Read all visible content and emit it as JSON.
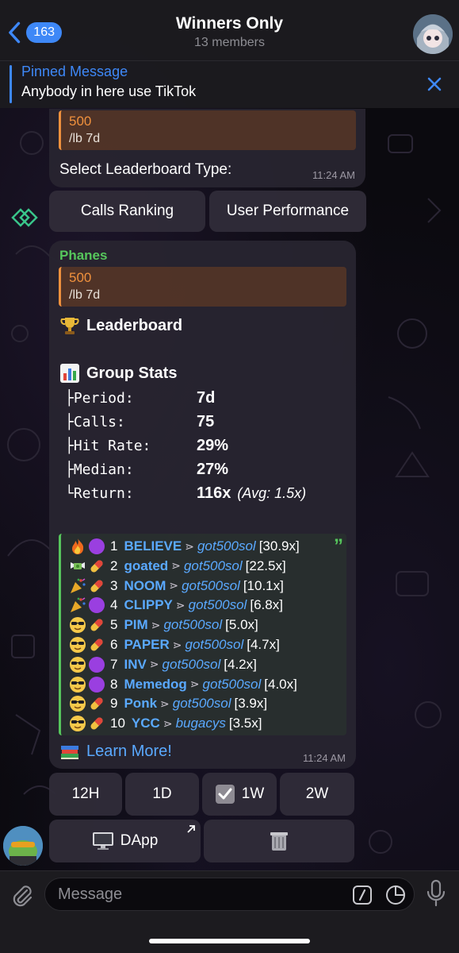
{
  "header": {
    "unread_count": "163",
    "title": "Winners Only",
    "subtitle": "13 members"
  },
  "pinned": {
    "title": "Pinned Message",
    "text": "Anybody in here use TikTok"
  },
  "message1": {
    "reply_title": "500",
    "reply_text": "/lb 7d",
    "text": "Select Leaderboard Type:",
    "time": "11:24 AM"
  },
  "keyboard1": {
    "calls_ranking": "Calls Ranking",
    "user_performance": "User Performance"
  },
  "message2": {
    "sender": "Phanes",
    "reply_title": "500",
    "reply_text": "/lb 7d",
    "leaderboard_title": "Leaderboard",
    "group_stats_title": "Group Stats",
    "stats": [
      {
        "label": "├Period:",
        "value": "7d",
        "note": ""
      },
      {
        "label": "├Calls:",
        "value": "75",
        "note": ""
      },
      {
        "label": "├Hit Rate:",
        "value": "29%",
        "note": ""
      },
      {
        "label": "├Median:",
        "value": "27%",
        "note": ""
      },
      {
        "label": "└Return:",
        "value": "116x",
        "note": "(Avg: 1.5x)"
      }
    ],
    "leaderboard": [
      {
        "icons": [
          "fire",
          "purple-circle"
        ],
        "rank": "1",
        "token": "BELIEVE",
        "user": "got500sol",
        "mult": "[30.9x]"
      },
      {
        "icons": [
          "money-with-wings",
          "pill"
        ],
        "rank": "2",
        "token": "goated",
        "user": "got500sol",
        "mult": "[22.5x]"
      },
      {
        "icons": [
          "party-popper",
          "pill"
        ],
        "rank": "3",
        "token": "NOOM",
        "user": "got500sol",
        "mult": "[10.1x]"
      },
      {
        "icons": [
          "party-popper",
          "purple-circle"
        ],
        "rank": "4",
        "token": "CLIPPY",
        "user": "got500sol",
        "mult": "[6.8x]"
      },
      {
        "icons": [
          "sunglasses-face",
          "pill"
        ],
        "rank": "5",
        "token": "PIM",
        "user": "got500sol",
        "mult": "[5.0x]"
      },
      {
        "icons": [
          "sunglasses-face",
          "pill"
        ],
        "rank": "6",
        "token": "PAPER",
        "user": "got500sol",
        "mult": "[4.7x]"
      },
      {
        "icons": [
          "sunglasses-face",
          "purple-circle"
        ],
        "rank": "7",
        "token": "INV",
        "user": "got500sol",
        "mult": "[4.2x]"
      },
      {
        "icons": [
          "sunglasses-face",
          "purple-circle"
        ],
        "rank": "8",
        "token": "Memedog",
        "user": "got500sol",
        "mult": "[4.0x]"
      },
      {
        "icons": [
          "sunglasses-face",
          "pill"
        ],
        "rank": "9",
        "token": "Ponk",
        "user": "got500sol",
        "mult": "[3.9x]"
      },
      {
        "icons": [
          "sunglasses-face",
          "pill"
        ],
        "rank": "10",
        "token": "YCC",
        "user": "bugacys",
        "mult": "[3.5x]"
      }
    ],
    "learn_more": "Learn More!",
    "time": "11:24 AM"
  },
  "keyboard2": {
    "h12": "12H",
    "d1": "1D",
    "w1": "1W",
    "w2": "2W",
    "dapp": "DApp"
  },
  "input": {
    "placeholder": "Message"
  },
  "colors": {
    "accent_blue": "#3e88f7",
    "link_blue": "#5aa9ff",
    "sender_green": "#56c65c",
    "reply_orange": "#f0913d"
  }
}
